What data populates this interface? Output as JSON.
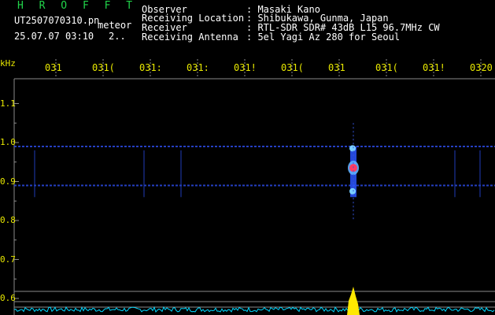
{
  "header": {
    "brand": "H R O F F T",
    "filename": "UT2507070310.pn",
    "meteor_tag": "meteor",
    "datetime": "25.07.07 03:10",
    "count": "2..",
    "info": [
      {
        "key": "Observer",
        "value": ": Masaki Kano"
      },
      {
        "key": "Receiving Location",
        "value": ": Shibukawa, Gunma, Japan"
      },
      {
        "key": "Receiver",
        "value": ": RTL-SDR SDR# 43dB L15 96.7MHz CW"
      },
      {
        "key": "Receiving Antenna",
        "value": ": 5el Yagi Az 280 for Seoul"
      }
    ]
  },
  "chart_data": {
    "type": "heatmap",
    "ylabel": "kHz",
    "yticks": [
      "1.1",
      "1.0",
      "0.9",
      "0.8",
      "0.7",
      "0.6"
    ],
    "xticks": [
      "031",
      "031(",
      "031:",
      "031:",
      "031!",
      "031(",
      "031",
      "031(",
      "031!",
      "0320"
    ],
    "ylim": [
      0.58,
      1.15
    ],
    "carrier_lines_khz": [
      0.99,
      0.89,
      0.62
    ],
    "meteor_echo": {
      "time_label": "0317",
      "freq_khz": [
        0.86,
        0.99
      ],
      "peak_khz": 0.935
    }
  },
  "colors": {
    "background": "#000000",
    "grid": "#8a8a8a",
    "brand": "#21d44a",
    "labels": "#e8e800",
    "noise_floor": "#00d8ff",
    "signal_peak": "#ffe800",
    "echo_core": "#ff3c64"
  }
}
